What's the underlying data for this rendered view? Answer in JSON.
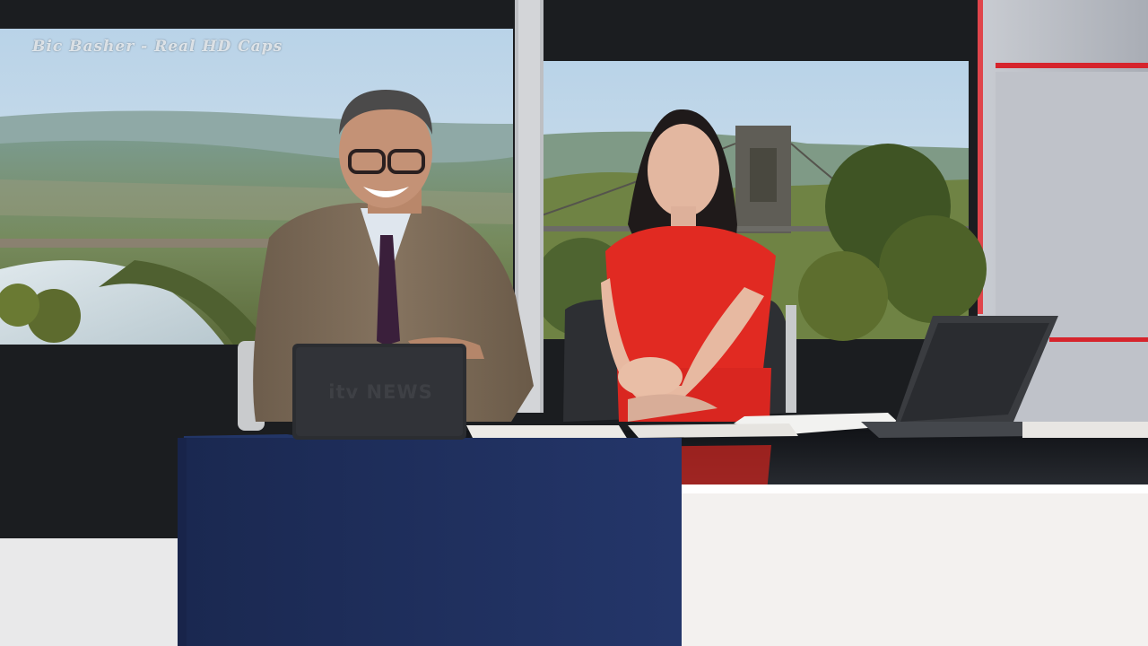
{
  "watermark": {
    "text": "Bic Basher - Real HD Caps"
  },
  "laptop": {
    "logo_text": "itv NEWS"
  },
  "colors": {
    "studio_wall": "#1b1d20",
    "screen_sky": "#a9c6de",
    "presenter_dress": "#e12a22",
    "presenter_suit": "#7b6a58",
    "desk_front": "#1d2d57",
    "desk_white": "#f3f1ef",
    "accent_red": "#d6242c"
  }
}
